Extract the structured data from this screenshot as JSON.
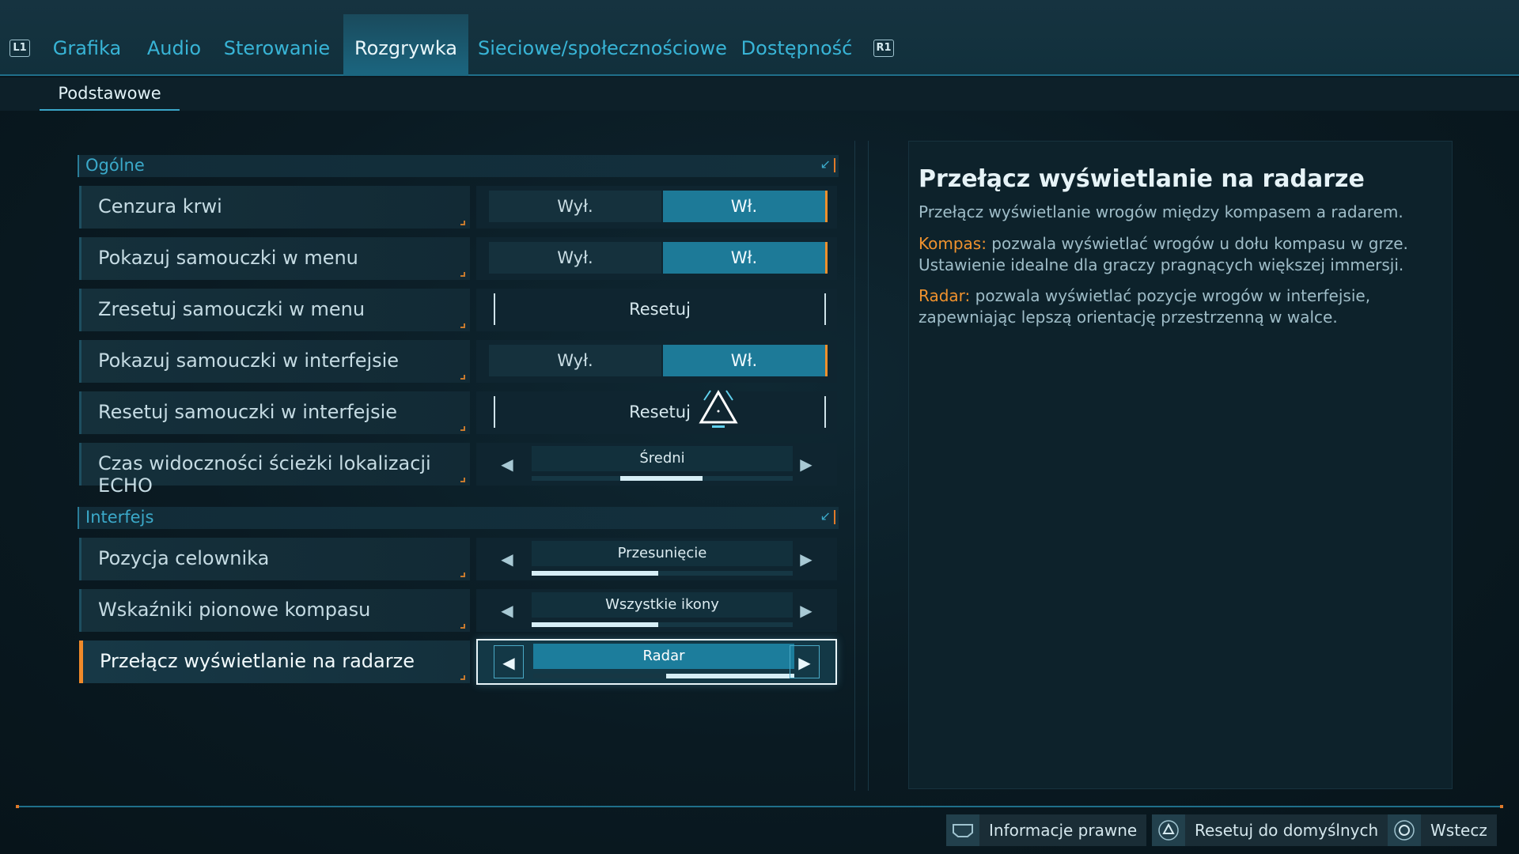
{
  "tabs": {
    "left_shoulder": "L1",
    "right_shoulder": "R1",
    "items": [
      "Grafika",
      "Audio",
      "Sterowanie",
      "Rozgrywka",
      "Sieciowe/społecznościowe",
      "Dostępność"
    ],
    "active": "Rozgrywka"
  },
  "subtabs": {
    "active": "Podstawowe"
  },
  "sections": {
    "general": {
      "title": "Ogólne",
      "rows": [
        {
          "label": "Cenzura krwi",
          "off": "Wył.",
          "on": "Wł."
        },
        {
          "label": "Pokazuj samouczki w menu",
          "off": "Wył.",
          "on": "Wł."
        },
        {
          "label": "Zresetuj samouczki w menu",
          "button": "Resetuj"
        },
        {
          "label": "Pokazuj samouczki w interfejsie",
          "off": "Wył.",
          "on": "Wł."
        },
        {
          "label": "Resetuj samouczki w interfejsie",
          "button": "Resetuj"
        },
        {
          "label": "Czas widoczności ścieżki lokalizacji ECHO",
          "value": "Średni"
        }
      ]
    },
    "interface": {
      "title": "Interfejs",
      "rows": [
        {
          "label": "Pozycja celownika",
          "value": "Przesunięcie"
        },
        {
          "label": "Wskaźniki pionowe kompasu",
          "value": "Wszystkie ikony"
        },
        {
          "label": "Przełącz wyświetlanie na radarze",
          "value": "Radar"
        }
      ]
    }
  },
  "info": {
    "title": "Przełącz wyświetlanie na radarze",
    "description": "Przełącz wyświetlanie wrogów między kompasem a radarem.",
    "p1_key": "Kompas:",
    "p1_text": " pozwala wyświetlać wrogów u dołu kompasu w grze. Ustawienie idealne dla graczy pragnących większej immersji.",
    "p2_key": "Radar:",
    "p2_text": " pozwala wyświetlać pozycje wrogów w interfejsie, zapewniając lepszą orientację przestrzenną w walce."
  },
  "footer": {
    "legal": "Informacje prawne",
    "reset_defaults": "Resetuj do domyślnych",
    "back": "Wstecz"
  },
  "colors": {
    "accent": "#1d7a98",
    "highlight": "#f0902c",
    "tab_text": "#38b4d6"
  },
  "icons": {
    "left_arrow": "chevron-left-icon",
    "right_arrow": "chevron-right-icon",
    "touchpad": "touchpad-icon",
    "triangle": "triangle-button-icon",
    "circle": "circle-button-icon"
  }
}
